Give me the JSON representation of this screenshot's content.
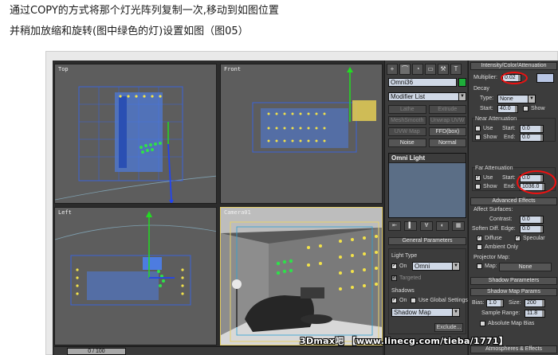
{
  "captions": {
    "line1": "通过COPY的方式将那个灯光阵列复制一次,移动到如图位置",
    "line2": "并稍加放缩和旋转(图中绿色的灯)设置如图（图05）"
  },
  "viewports": {
    "top": "Top",
    "front": "Front",
    "left": "Left",
    "camera": "Camera01"
  },
  "timeline": {
    "slider_label": "0 / 100"
  },
  "command_panel": {
    "tabs": [
      "+",
      "⌒",
      "◔",
      "▭",
      "⚒",
      "T"
    ],
    "object_name": "Omni36",
    "modifier_list": "Modifier List",
    "modifier_buttons": [
      "Lathe",
      "Extrude",
      "MeshSmooth",
      "Unwrap UVW",
      "UVW Map",
      "FFD(box)",
      "Noise",
      "Normal"
    ],
    "stack_item": "Omni Light",
    "general_parameters": {
      "title": "General Parameters",
      "light_type_label": "Light Type",
      "on_label": "On",
      "light_type_value": "Omni",
      "targeted_label": "Targeted",
      "shadows_label": "Shadows",
      "shadows_on_label": "On",
      "use_global_label": "Use Global Settings",
      "shadow_type": "Shadow Map",
      "exclude_button": "Exclude..."
    }
  },
  "params_panel": {
    "intensity_title": "Intensity/Color/Attenuation",
    "multiplier_label": "Multiplier:",
    "multiplier_value": "0.02",
    "decay_label": "Decay",
    "type_label": "Type:",
    "type_value": "None",
    "start_label": "Start:",
    "start_value": "40.0",
    "show_label": "Show",
    "near_attenuation_label": "Near Attenuation",
    "near_use_label": "Use",
    "near_show_label": "Show",
    "near_start_label": "Start:",
    "near_start_value": "0.0",
    "near_end_label": "End:",
    "near_end_value": "0.0",
    "far_attenuation_label": "Far Attenuation",
    "far_use_label": "Use",
    "far_show_label": "Show",
    "far_start_label": "Start:",
    "far_start_value": "0.0",
    "far_end_label": "End:",
    "far_end_value": "1036.0",
    "advanced_title": "Advanced Effects",
    "affect_surfaces_label": "Affect Surfaces:",
    "contrast_label": "Contrast:",
    "contrast_value": "0.0",
    "soften_label": "Soften Diff. Edge:",
    "soften_value": "0.0",
    "diffuse_label": "Diffuse",
    "specular_label": "Specular",
    "ambient_label": "Ambient Only",
    "projector_label": "Projector Map:",
    "map_label": "Map:",
    "map_value": "None",
    "shadow_params_title": "Shadow Parameters",
    "shadow_map_params_title": "Shadow Map Params",
    "bias_label": "Bias:",
    "bias_value": "1.0",
    "size_label": "Size:",
    "size_value": "200",
    "sample_range_label": "Sample Range:",
    "sample_range_value": "11.8",
    "absolute_bias_label": "Absolute Map Bias",
    "atmos_title": "Atmospheres & Effects"
  },
  "watermark": "3Dmax吧 【www.linecg.com/tieba/1771】",
  "colors": {
    "light_swatch": "#1fae3a",
    "highlight": "#ee1111",
    "viewport_bg": "#5d5d5d"
  }
}
